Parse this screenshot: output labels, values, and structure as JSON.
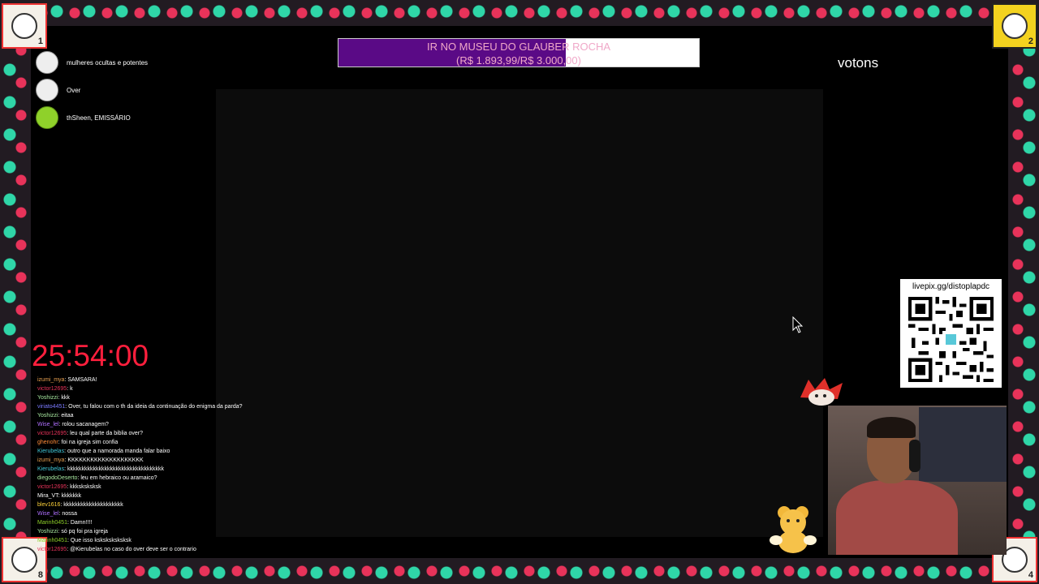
{
  "donors": [
    {
      "name": "mulheres ocultas e potentes"
    },
    {
      "name": "Over"
    },
    {
      "name": "thSheen, EMISSÁRIO"
    }
  ],
  "goal": {
    "title": "IR NO MUSEU DO GLAUBER ROCHA",
    "amount": "(R$ 1.893,99/R$ 3.000,00)",
    "progress": 0.63,
    "fill_color": "#5a0a86",
    "text_color": "#f0a8c8"
  },
  "votons_label": "votons",
  "timer": "25:54:00",
  "qr": {
    "caption": "livepix.gg/distoplapdc"
  },
  "corners": {
    "top_left": "1",
    "top_right": "2",
    "bottom_left": "8",
    "bottom_right": "4"
  },
  "chat": [
    {
      "user": "izumi_mya",
      "color": "#e8a050",
      "text": ": SAMSARA!"
    },
    {
      "user": "victor12695",
      "color": "#e8335a",
      "text": ": k"
    },
    {
      "user": "Yoshizzi",
      "color": "#a8e8a0",
      "text": ": kkk"
    },
    {
      "user": "viriato4451",
      "color": "#7a7aff",
      "text": ": Over, tu falou com o th da ideia da continuação do enigma da parda?"
    },
    {
      "user": "Yoshizzi",
      "color": "#a8e8a0",
      "text": ": eitaa"
    },
    {
      "user": "Wise_lel",
      "color": "#b070ff",
      "text": ": rolou sacanagem?"
    },
    {
      "user": "victor12695",
      "color": "#e8335a",
      "text": ": leu qual parte da biblia over?"
    },
    {
      "user": "ghenohr",
      "color": "#ff8c3a",
      "text": ": foi na igreja sim confia"
    },
    {
      "user": "Kierubelas",
      "color": "#40c8d8",
      "text": ": outro que a namorada manda falar baixo"
    },
    {
      "user": "izumi_mya",
      "color": "#e8a050",
      "text": ": KKKKKKKKKKKKKKKKKKKK"
    },
    {
      "user": "Kierubelas",
      "color": "#40c8d8",
      "text": ": kkkkkkkkkkkkkkkkkkkkkkkkkkkkkkkkkk"
    },
    {
      "user": "diegodoDeserto",
      "color": "#a8e8a0",
      "text": ": leu em hebraico ou aramaico?"
    },
    {
      "user": "victor12695",
      "color": "#e8335a",
      "text": ": kkksksksksk"
    },
    {
      "user": "Mira_VT",
      "color": "#ffffff",
      "text": ": kkkkkkk"
    },
    {
      "user": "blev1616",
      "color": "#ffd23a",
      "text": ": kkkkkkkkkkkkkkkkkkkkk"
    },
    {
      "user": "Wise_lel",
      "color": "#b070ff",
      "text": ": nossa"
    },
    {
      "user": "Marinh0451",
      "color": "#8fd12a",
      "text": ": Damn!!!!"
    },
    {
      "user": "Yoshizzi",
      "color": "#a8e8a0",
      "text": ": só pq foi pra igreja"
    },
    {
      "user": "Marinh0451",
      "color": "#8fd12a",
      "text": ": Que isso ksksksksksksk"
    },
    {
      "user": "victor12695",
      "color": "#e8335a",
      "text": ": @Kierubelas no caso do over deve ser o contrario"
    }
  ]
}
